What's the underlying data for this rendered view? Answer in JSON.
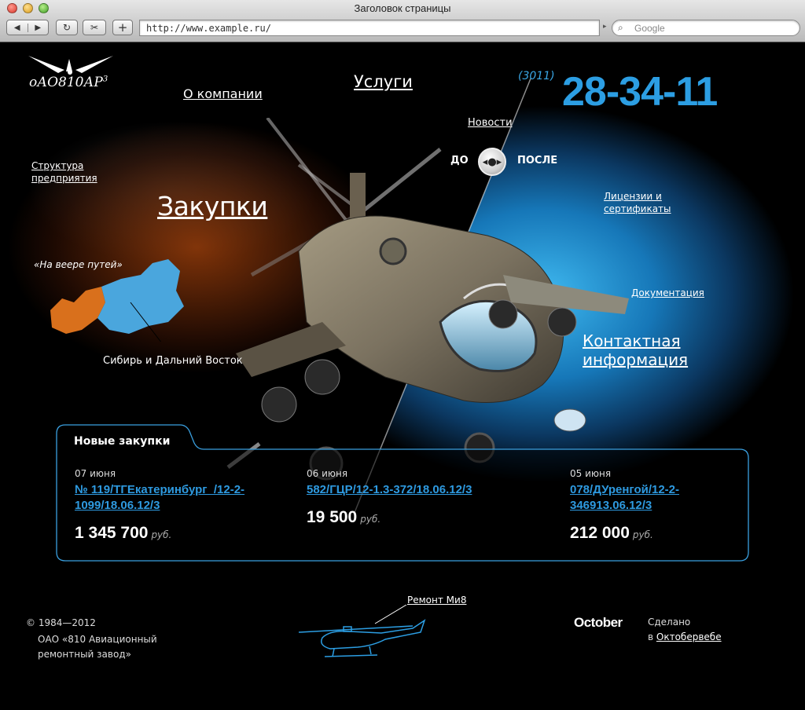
{
  "browser": {
    "title": "Заголовок страницы",
    "url": "http://www.example.ru/",
    "search_placeholder": "Google"
  },
  "site": {
    "logo_text": "оАО810АР",
    "logo_sup": "3",
    "nav": {
      "about": "О компании",
      "services": "Услуги",
      "news": "Новости",
      "structure": "Структура предприятия",
      "purchases": "Закупки",
      "licenses": "Лицензии и сертификаты",
      "documentation": "Документация",
      "contacts": "Контактная информация"
    },
    "phone": {
      "code": "(3011)",
      "number": "28-34-11"
    },
    "switch": {
      "before": "ДО",
      "after": "ПОСЛЕ"
    },
    "motto": "«На веере путей»",
    "region": "Сибирь и Дальний Восток",
    "colors": {
      "accent": "#2c9ee3",
      "panel_border": "#3aa0e0",
      "map_left": "#d9701c",
      "map_right": "#4aa6dd"
    }
  },
  "purchases": {
    "title": "Новые закупки",
    "items": [
      {
        "date": "07 июня",
        "link": "№ 119/ТГЕкатеринбург_/12-2-1099/18.06.12/3",
        "sum": "1 345 700",
        "currency": "руб."
      },
      {
        "date": "06 июня",
        "link": "582/ГЦР/12-1.3-372/18.06.12/3",
        "sum": "19 500",
        "currency": "руб."
      },
      {
        "date": "05 июня",
        "link": "078/ДУренгой/12-2-346913.06.12/3",
        "sum": "212 000",
        "currency": "руб."
      }
    ]
  },
  "footer": {
    "copyright": "© 1984—2012",
    "company": "ОАО «810 Авиационный ремонтный завод»",
    "repair_link": "Ремонт Ми8",
    "developer_logo": "October",
    "made_label": "Сделано",
    "made_in": "в",
    "developer_link": "Октобервебе"
  }
}
